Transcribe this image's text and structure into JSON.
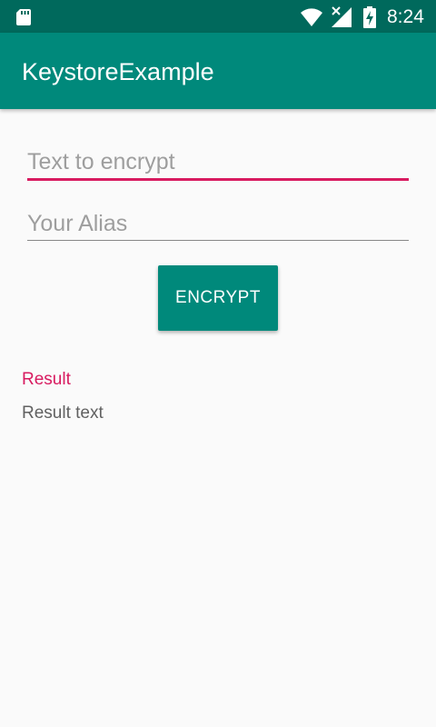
{
  "status_bar": {
    "time": "8:24",
    "icons": [
      "sd-card-icon",
      "wifi-icon",
      "cell-signal-icon",
      "battery-charging-icon"
    ]
  },
  "app_bar": {
    "title": "KeystoreExample"
  },
  "form": {
    "text_to_encrypt": {
      "placeholder": "Text to encrypt",
      "value": ""
    },
    "alias": {
      "placeholder": "Your Alias",
      "value": ""
    },
    "encrypt_label": "ENCRYPT"
  },
  "result": {
    "label": "Result",
    "text": "Result text"
  },
  "colors": {
    "status_bar": "#00695c",
    "primary": "#00897b",
    "accent": "#d81b60",
    "background": "#fafafa"
  }
}
